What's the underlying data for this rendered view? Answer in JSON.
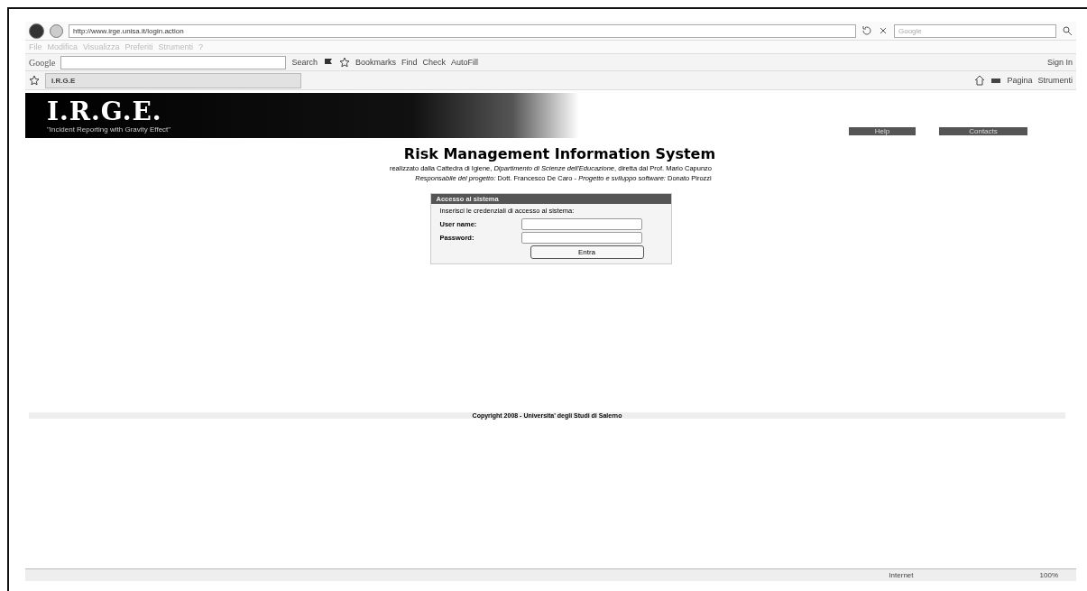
{
  "address_bar": {
    "url": "http://www.irge.unisa.it/login.action",
    "search_placeholder": "Google"
  },
  "menu_bar": {
    "items": [
      "File",
      "Modifica",
      "Visualizza",
      "Preferiti",
      "Strumenti",
      "?"
    ],
    "disabled": true
  },
  "google_toolbar": {
    "brand": "Google",
    "search": "Search",
    "bookmarks": "Bookmarks",
    "find": "Find",
    "check": "Check",
    "autofill": "AutoFill",
    "sign_in": "Sign In"
  },
  "tabs": [
    {
      "label": "I.R.G.E",
      "selected": true
    }
  ],
  "command_bar": {
    "page": "Pagina",
    "tools": "Strumenti"
  },
  "page": {
    "banner": {
      "logo": "I.R.G.E.",
      "tagline": "\"Incident Reporting with Gravity Effect\""
    },
    "top_links": [
      "Help",
      "Contacts"
    ],
    "title": "Risk Management Information System",
    "subtitle_lines": [
      "realizzato dalla Cattedra di Igiene, *Dipartimento di Scienze dell'Educazione*, diretta dal Prof. Mario Capunzo",
      "*Responsabile del progetto:* Dott. Francesco De Caro - *Progetto e sviluppo software:* Donato Pirozzi"
    ],
    "login": {
      "title": "Accesso al sistema",
      "instruction": "Inserisci le credenziali di accesso al sistema:",
      "fields": [
        {
          "label": "User name:"
        },
        {
          "label": "Password:"
        }
      ],
      "button": "Entra"
    },
    "footer": "Copyright 2008 - Universita' degli Studi di Salerno"
  },
  "status_bar": {
    "zone": "Internet",
    "zoom": "100%"
  }
}
